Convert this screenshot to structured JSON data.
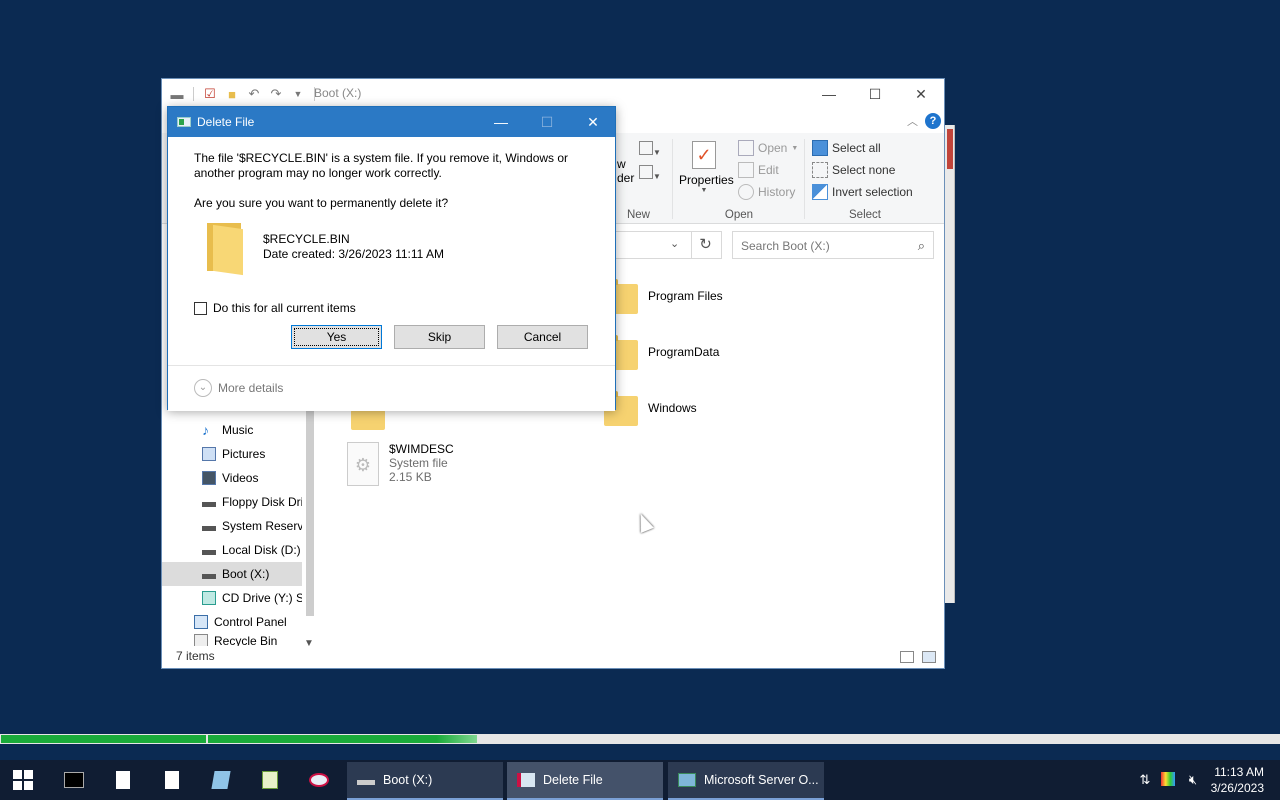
{
  "explorer": {
    "title": "Boot (X:)",
    "ribbon": {
      "new_group": {
        "label_partial_1": "w",
        "label_partial_2": "der",
        "label": "New"
      },
      "open_group": {
        "properties": "Properties",
        "open": "Open",
        "edit": "Edit",
        "history": "History",
        "label": "Open"
      },
      "select_group": {
        "select_all": "Select all",
        "select_none": "Select none",
        "invert_selection": "Invert selection",
        "label": "Select"
      }
    },
    "search": {
      "placeholder": "Search Boot (X:)"
    },
    "nav_items": [
      {
        "label": "Music",
        "icon": "music-icon"
      },
      {
        "label": "Pictures",
        "icon": "pictures-icon"
      },
      {
        "label": "Videos",
        "icon": "videos-icon"
      },
      {
        "label": "Floppy Disk Dri",
        "icon": "floppy-drive-icon"
      },
      {
        "label": "System Reserve",
        "icon": "drive-icon"
      },
      {
        "label": "Local Disk (D:)",
        "icon": "drive-icon"
      },
      {
        "label": "Boot (X:)",
        "icon": "drive-icon",
        "selected": true
      },
      {
        "label": "CD Drive (Y:) S:",
        "icon": "cd-drive-icon"
      },
      {
        "label": "Control Panel",
        "icon": "control-panel-icon"
      },
      {
        "label": "Recycle Bin",
        "icon": "recycle-bin-icon"
      }
    ],
    "files": [
      {
        "name": "Program Files",
        "icon": "folder-icon"
      },
      {
        "name": "ProgramData",
        "icon": "folder-icon"
      },
      {
        "name": "Windows",
        "icon": "folder-icon"
      },
      {
        "name": "$WIMDESC",
        "type": "System file",
        "size": "2.15 KB",
        "icon": "system-file-icon"
      }
    ],
    "status": {
      "item_count": "7 items"
    }
  },
  "dialog": {
    "title": "Delete File",
    "message_line1": "The file '$RECYCLE.BIN' is a system file. If you remove it, Windows or",
    "message_line2": "another program may no longer work correctly.",
    "question": "Are you sure you want to permanently delete it?",
    "file_name": "$RECYCLE.BIN",
    "date_created": "Date created: 3/26/2023 11:11 AM",
    "checkbox_label": "Do this for all current items",
    "checkbox_checked": false,
    "buttons": {
      "yes": "Yes",
      "skip": "Skip",
      "cancel": "Cancel"
    },
    "more_details": "More details"
  },
  "progress": {
    "segment1_fraction": 0.16,
    "segment2_fraction": 0.21,
    "color": "#1aab3a"
  },
  "taskbar": {
    "tasks": [
      {
        "label": "Boot (X:)",
        "icon": "drive-icon"
      },
      {
        "label": "Delete File",
        "icon": "delete-file-icon",
        "active": true
      },
      {
        "label": "Microsoft Server O...",
        "icon": "server-icon"
      }
    ],
    "clock": {
      "time": "11:13 AM",
      "date": "3/26/2023"
    }
  },
  "colors": {
    "dialog_titlebar": "#2b79c5",
    "desktop": "#0b2a52",
    "taskbar": "#101d33",
    "accent": "#0078d7"
  }
}
